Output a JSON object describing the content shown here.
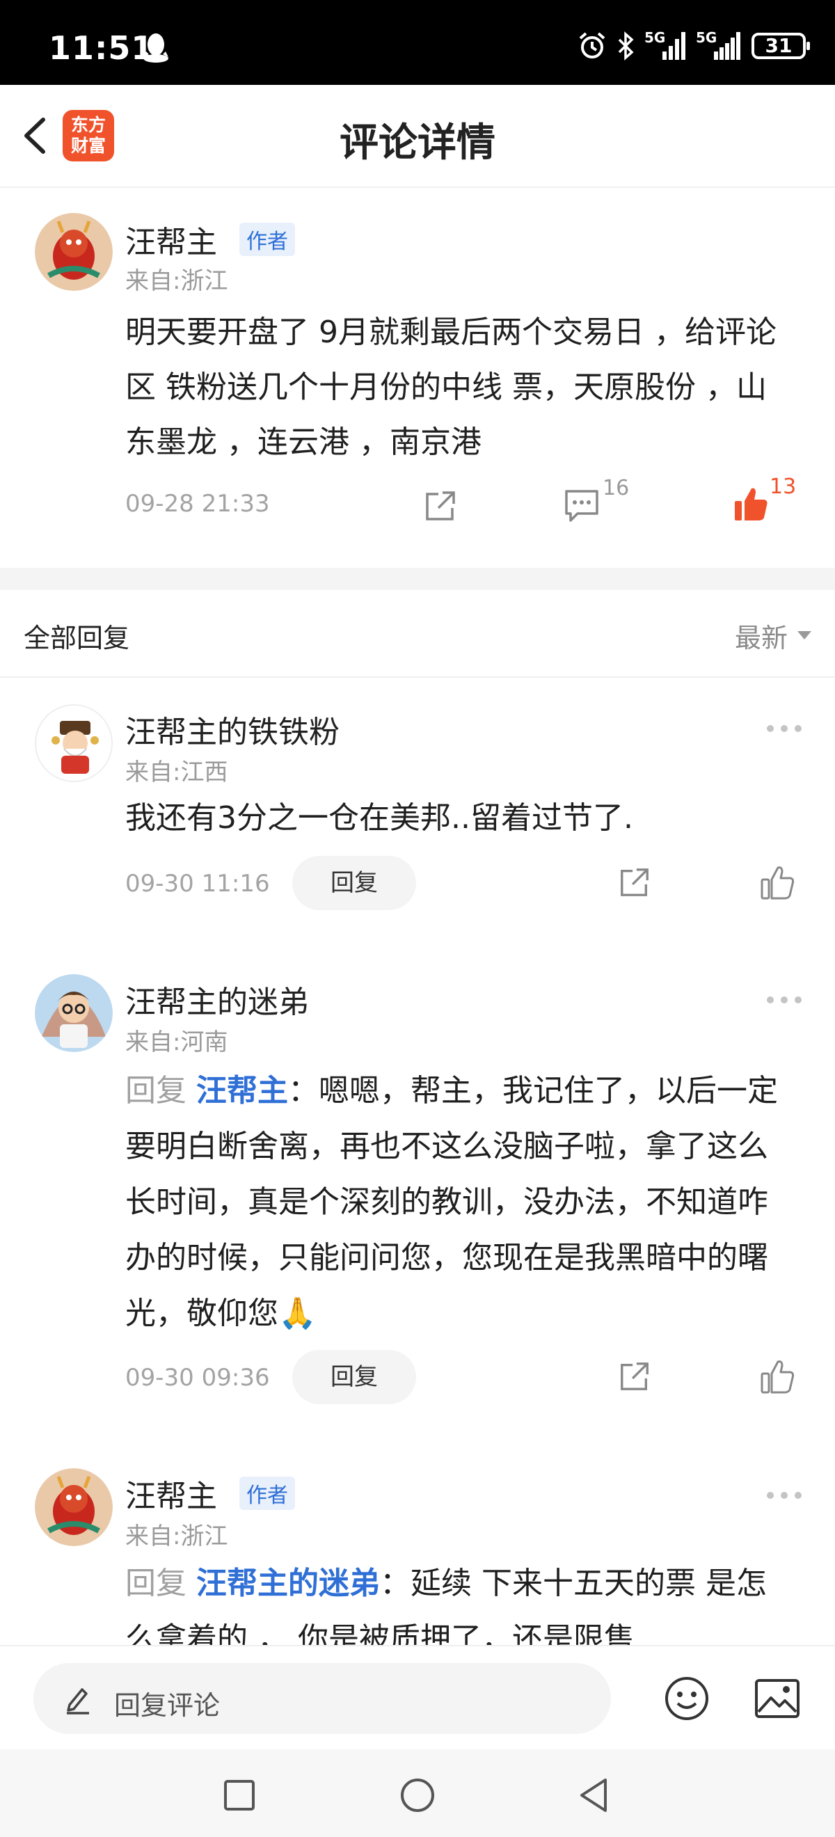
{
  "status": {
    "time": "11:51",
    "network_1": "5G",
    "network_2": "5G",
    "battery": "31"
  },
  "header": {
    "logo_line1": "东方",
    "logo_line2": "财富",
    "title": "评论详情"
  },
  "post": {
    "author": "汪帮主",
    "badge": "作者",
    "from": "来自:浙江",
    "body": "明天要开盘了 9月就剩最后两个交易日 ，给评论区 铁粉送几个十月份的中线 票，天原股份 ，山东墨龙 ，连云港 ，南京港",
    "time": "09-28 21:33",
    "comment_count": "16",
    "like_count": "13"
  },
  "replies_header": {
    "title": "全部回复",
    "sort": "最新"
  },
  "replies": [
    {
      "author": "汪帮主的铁铁粉",
      "from": "来自:江西",
      "text": "我还有3分之一仓在美邦..留着过节了.",
      "time": "09-30 11:16",
      "reply_label": "回复"
    },
    {
      "author": "汪帮主的迷弟",
      "from": "来自:河南",
      "prefix": "回复 ",
      "mention": "汪帮主",
      "text": "：嗯嗯，帮主，我记住了，以后一定要明白断舍离，再也不这么没脑子啦，拿了这么长时间，真是个深刻的教训，没办法，不知道咋办的时候，只能问问您，您现在是我黑暗中的曙光，敬仰您🙏",
      "time": "09-30 09:36",
      "reply_label": "回复"
    },
    {
      "author": "汪帮主",
      "badge": "作者",
      "from": "来自:浙江",
      "prefix": "回复 ",
      "mention": "汪帮主的迷弟",
      "text": "：延续 下来十五天的票 是怎么拿着的 ， 你是被质押了，还是限售"
    }
  ],
  "bottom": {
    "placeholder": "回复评论"
  },
  "colors": {
    "accent_orange": "#f0522b",
    "mention_blue": "#2f6fd6"
  }
}
